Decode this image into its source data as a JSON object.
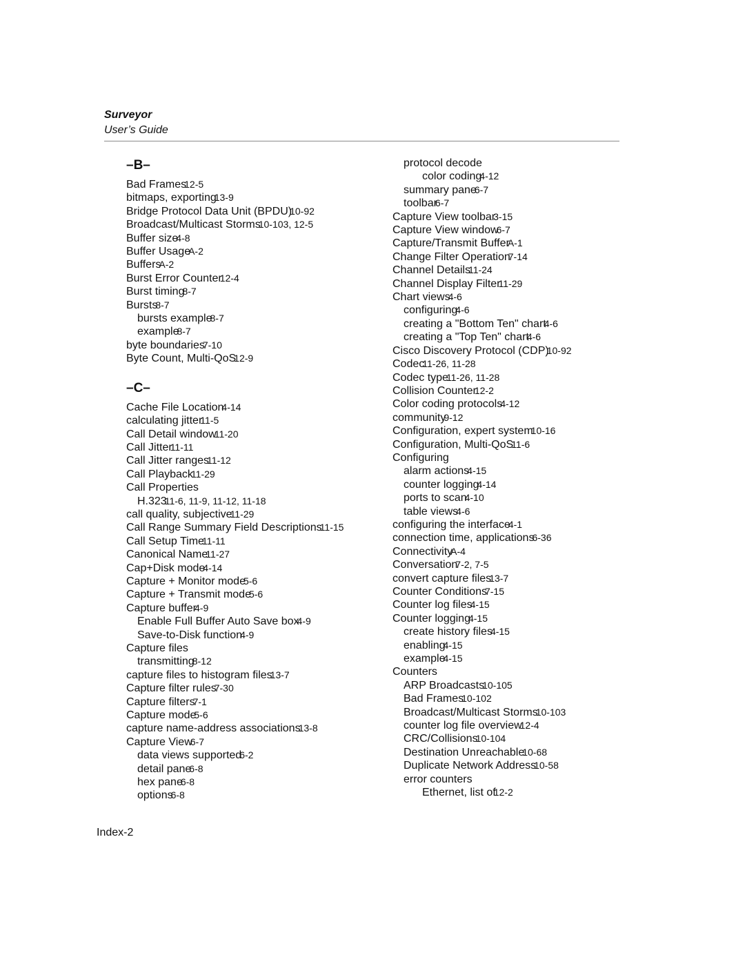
{
  "header": {
    "title": "Surveyor",
    "subtitle": "User’s Guide"
  },
  "left_column": [
    {
      "type": "letter",
      "text": "–B–"
    },
    {
      "type": "entry",
      "level": 1,
      "term": "Bad Frames",
      "pages": "12-5"
    },
    {
      "type": "entry",
      "level": 1,
      "term": "bitmaps, exporting",
      "pages": "13-9"
    },
    {
      "type": "entry",
      "level": 1,
      "term": "Bridge Protocol Data Unit (BPDU)",
      "pages": "10-92"
    },
    {
      "type": "entry",
      "level": 1,
      "term": "Broadcast/Multicast Storms",
      "pages": "10-103, 12-5"
    },
    {
      "type": "entry",
      "level": 1,
      "term": "Buffer size",
      "pages": "4-8"
    },
    {
      "type": "entry",
      "level": 1,
      "term": "Buffer Usage",
      "pages": "A-2"
    },
    {
      "type": "entry",
      "level": 1,
      "term": "Buffers",
      "pages": "A-2"
    },
    {
      "type": "entry",
      "level": 1,
      "term": "Burst Error Counter",
      "pages": "12-4"
    },
    {
      "type": "entry",
      "level": 1,
      "term": "Burst timing",
      "pages": "8-7"
    },
    {
      "type": "entry",
      "level": 1,
      "term": "Bursts",
      "pages": "8-7"
    },
    {
      "type": "entry",
      "level": 2,
      "term": "bursts example",
      "pages": "8-7"
    },
    {
      "type": "entry",
      "level": 2,
      "term": "example",
      "pages": "8-7"
    },
    {
      "type": "entry",
      "level": 1,
      "term": "byte boundaries",
      "pages": "7-10"
    },
    {
      "type": "entry",
      "level": 1,
      "term": "Byte Count, Multi-QoS",
      "pages": "12-9"
    },
    {
      "type": "letter",
      "text": "–C–"
    },
    {
      "type": "entry",
      "level": 1,
      "term": "Cache File Location",
      "pages": "4-14"
    },
    {
      "type": "entry",
      "level": 1,
      "term": "calculating jitter",
      "pages": "11-5"
    },
    {
      "type": "entry",
      "level": 1,
      "term": "Call Detail window",
      "pages": "11-20"
    },
    {
      "type": "entry",
      "level": 1,
      "term": "Call Jitter",
      "pages": "11-11"
    },
    {
      "type": "entry",
      "level": 1,
      "term": "Call Jitter ranges",
      "pages": "11-12"
    },
    {
      "type": "entry",
      "level": 1,
      "term": "Call Playback",
      "pages": "11-29"
    },
    {
      "type": "entry",
      "level": 1,
      "term": "Call Properties",
      "pages": ""
    },
    {
      "type": "entry",
      "level": 2,
      "term": "H.323",
      "pages": "11-6, 11-9, 11-12, 11-18"
    },
    {
      "type": "entry",
      "level": 1,
      "term": "call quality, subjective",
      "pages": "11-29"
    },
    {
      "type": "entry",
      "level": 1,
      "term": "Call Range Summary Field Descriptions",
      "pages": "11-15"
    },
    {
      "type": "entry",
      "level": 1,
      "term": "Call Setup Time",
      "pages": "11-11"
    },
    {
      "type": "entry",
      "level": 1,
      "term": "Canonical Name",
      "pages": "11-27"
    },
    {
      "type": "entry",
      "level": 1,
      "term": "Cap+Disk mode",
      "pages": "4-14"
    },
    {
      "type": "entry",
      "level": 1,
      "term": "Capture + Monitor mode",
      "pages": "5-6"
    },
    {
      "type": "entry",
      "level": 1,
      "term": "Capture + Transmit mode",
      "pages": "5-6"
    },
    {
      "type": "entry",
      "level": 1,
      "term": "Capture buffer",
      "pages": "4-9"
    },
    {
      "type": "entry",
      "level": 2,
      "term": "Enable Full Buffer Auto Save box",
      "pages": "4-9"
    },
    {
      "type": "entry",
      "level": 2,
      "term": "Save-to-Disk function",
      "pages": "4-9"
    },
    {
      "type": "entry",
      "level": 1,
      "term": "Capture files",
      "pages": ""
    },
    {
      "type": "entry",
      "level": 2,
      "term": "transmitting",
      "pages": "8-12"
    },
    {
      "type": "entry",
      "level": 1,
      "term": "capture files to histogram files",
      "pages": "13-7"
    },
    {
      "type": "entry",
      "level": 1,
      "term": "Capture filter rules",
      "pages": "7-30"
    },
    {
      "type": "entry",
      "level": 1,
      "term": "Capture filters",
      "pages": "7-1"
    },
    {
      "type": "entry",
      "level": 1,
      "term": "Capture mode",
      "pages": "5-6"
    },
    {
      "type": "entry",
      "level": 1,
      "term": "capture name-address associations",
      "pages": "13-8"
    },
    {
      "type": "entry",
      "level": 1,
      "term": "Capture View",
      "pages": "6-7"
    },
    {
      "type": "entry",
      "level": 2,
      "term": "data views supported",
      "pages": "6-2"
    },
    {
      "type": "entry",
      "level": 2,
      "term": "detail pane",
      "pages": "6-8"
    },
    {
      "type": "entry",
      "level": 2,
      "term": "hex pane",
      "pages": "6-8"
    },
    {
      "type": "entry",
      "level": 2,
      "term": "options",
      "pages": "6-8"
    }
  ],
  "right_column": [
    {
      "type": "entry",
      "level": 2,
      "term": "protocol decode",
      "pages": ""
    },
    {
      "type": "entry",
      "level": 3,
      "term": "color coding",
      "pages": "4-12"
    },
    {
      "type": "entry",
      "level": 2,
      "term": "summary pane",
      "pages": "6-7"
    },
    {
      "type": "entry",
      "level": 2,
      "term": "toolbar",
      "pages": "6-7"
    },
    {
      "type": "entry",
      "level": 1,
      "term": "Capture View toolbar",
      "pages": "3-15"
    },
    {
      "type": "entry",
      "level": 1,
      "term": "Capture View window",
      "pages": "6-7"
    },
    {
      "type": "entry",
      "level": 1,
      "term": "Capture/Transmit Buffer",
      "pages": "A-1"
    },
    {
      "type": "entry",
      "level": 1,
      "term": "Change Filter Operation",
      "pages": "7-14"
    },
    {
      "type": "entry",
      "level": 1,
      "term": "Channel Details",
      "pages": "11-24"
    },
    {
      "type": "entry",
      "level": 1,
      "term": "Channel Display Filter",
      "pages": "11-29"
    },
    {
      "type": "entry",
      "level": 1,
      "term": "Chart views",
      "pages": "4-6"
    },
    {
      "type": "entry",
      "level": 2,
      "term": "configuring",
      "pages": "4-6"
    },
    {
      "type": "entry",
      "level": 2,
      "term": "creating a \"Bottom Ten\" chart",
      "pages": "4-6"
    },
    {
      "type": "entry",
      "level": 2,
      "term": "creating a \"Top Ten\" chart",
      "pages": "4-6"
    },
    {
      "type": "entry",
      "level": 1,
      "term": "Cisco Discovery Protocol (CDP)",
      "pages": "10-92"
    },
    {
      "type": "entry",
      "level": 1,
      "term": "Codec",
      "pages": "11-26, 11-28"
    },
    {
      "type": "entry",
      "level": 1,
      "term": "Codec type",
      "pages": "11-26, 11-28"
    },
    {
      "type": "entry",
      "level": 1,
      "term": "Collision Counter",
      "pages": "12-2"
    },
    {
      "type": "entry",
      "level": 1,
      "term": "Color coding protocols",
      "pages": "4-12"
    },
    {
      "type": "entry",
      "level": 1,
      "term": "community",
      "pages": "9-12"
    },
    {
      "type": "entry",
      "level": 1,
      "term": "Configuration, expert system",
      "pages": "10-16"
    },
    {
      "type": "entry",
      "level": 1,
      "term": "Configuration, Multi-QoS",
      "pages": "11-6"
    },
    {
      "type": "entry",
      "level": 1,
      "term": "Configuring",
      "pages": ""
    },
    {
      "type": "entry",
      "level": 2,
      "term": "alarm actions",
      "pages": "4-15"
    },
    {
      "type": "entry",
      "level": 2,
      "term": "counter logging",
      "pages": "4-14"
    },
    {
      "type": "entry",
      "level": 2,
      "term": "ports to scan",
      "pages": "4-10"
    },
    {
      "type": "entry",
      "level": 2,
      "term": "table views",
      "pages": "4-6"
    },
    {
      "type": "entry",
      "level": 1,
      "term": "configuring the interface",
      "pages": "4-1"
    },
    {
      "type": "entry",
      "level": 1,
      "term": "connection time, applications",
      "pages": "6-36"
    },
    {
      "type": "entry",
      "level": 1,
      "term": "Connectivity",
      "pages": "A-4"
    },
    {
      "type": "entry",
      "level": 1,
      "term": "Conversation",
      "pages": "7-2, 7-5"
    },
    {
      "type": "entry",
      "level": 1,
      "term": "convert capture files",
      "pages": "13-7"
    },
    {
      "type": "entry",
      "level": 1,
      "term": "Counter Conditions",
      "pages": "7-15"
    },
    {
      "type": "entry",
      "level": 1,
      "term": "Counter log files",
      "pages": "4-15"
    },
    {
      "type": "entry",
      "level": 1,
      "term": "Counter logging",
      "pages": "4-15"
    },
    {
      "type": "entry",
      "level": 2,
      "term": "create history files",
      "pages": "4-15"
    },
    {
      "type": "entry",
      "level": 2,
      "term": "enabling",
      "pages": "4-15"
    },
    {
      "type": "entry",
      "level": 2,
      "term": "example",
      "pages": "4-15"
    },
    {
      "type": "entry",
      "level": 1,
      "term": "Counters",
      "pages": ""
    },
    {
      "type": "entry",
      "level": 2,
      "term": "ARP Broadcasts",
      "pages": "10-105"
    },
    {
      "type": "entry",
      "level": 2,
      "term": "Bad Frames",
      "pages": "10-102"
    },
    {
      "type": "entry",
      "level": 2,
      "term": "Broadcast/Multicast Storms",
      "pages": "10-103"
    },
    {
      "type": "entry",
      "level": 2,
      "term": "counter log file overview",
      "pages": "12-4"
    },
    {
      "type": "entry",
      "level": 2,
      "term": "CRC/Collisions",
      "pages": "10-104"
    },
    {
      "type": "entry",
      "level": 2,
      "term": "Destination Unreachable",
      "pages": "10-68"
    },
    {
      "type": "entry",
      "level": 2,
      "term": "Duplicate Network Address",
      "pages": "10-58"
    },
    {
      "type": "entry",
      "level": 2,
      "term": "error counters",
      "pages": ""
    },
    {
      "type": "entry",
      "level": 3,
      "term": "Ethernet, list of",
      "pages": "12-2"
    }
  ],
  "footer": {
    "page_label": "Index-2"
  }
}
